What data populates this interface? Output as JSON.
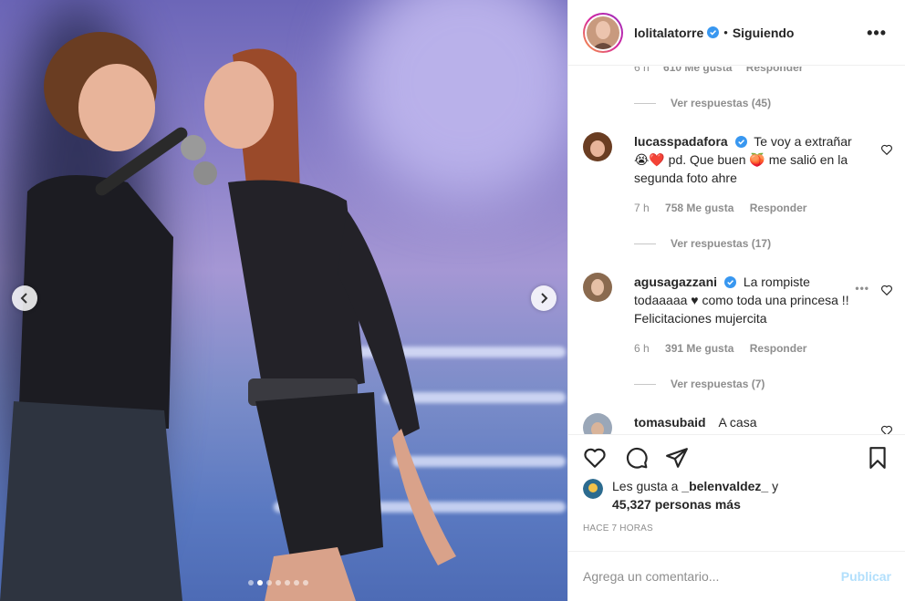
{
  "post": {
    "username": "lolitalatorre",
    "separator": "•",
    "follow_status": "Siguiendo",
    "more_label": "•••"
  },
  "carousel": {
    "dot_count": 7,
    "active_dot": 1
  },
  "partial_comment": {
    "time": "6 h",
    "likes": "610 Me gusta",
    "reply": "Responder"
  },
  "comments": [
    {
      "username": "lucasspadafora",
      "text": "Te voy a extrañar 😭❤️ pd. Que buen 🍑 me salió en la segunda foto ahre",
      "time": "7 h",
      "likes": "758 Me gusta",
      "reply": "Responder",
      "view_replies": "Ver respuestas (17)"
    },
    {
      "username": "agusagazzani",
      "text": "La rompiste todaaaaa ♥ como toda una princesa !! Felicitaciones mujercita",
      "time": "6 h",
      "likes": "391 Me gusta",
      "reply": "Responder",
      "view_replies": "Ver respuestas (7)"
    },
    {
      "username": "tomasubaid",
      "text": "A casa"
    }
  ],
  "top_view_replies": "Ver respuestas (45)",
  "likes": {
    "prefix": "Les gusta a",
    "user": "_belenvaldez_",
    "conj": "y",
    "count": "45,327 personas más"
  },
  "timestamp": "HACE 7 HORAS",
  "add_comment": {
    "placeholder": "Agrega un comentario...",
    "post_label": "Publicar"
  },
  "colors": {
    "verified": "#3897f0",
    "accent_blue": "#b2dffc"
  },
  "icons": [
    "verified-badge-icon",
    "heart-icon",
    "comment-icon",
    "share-icon",
    "bookmark-icon",
    "chevron-left-icon",
    "chevron-right-icon",
    "more-icon"
  ]
}
